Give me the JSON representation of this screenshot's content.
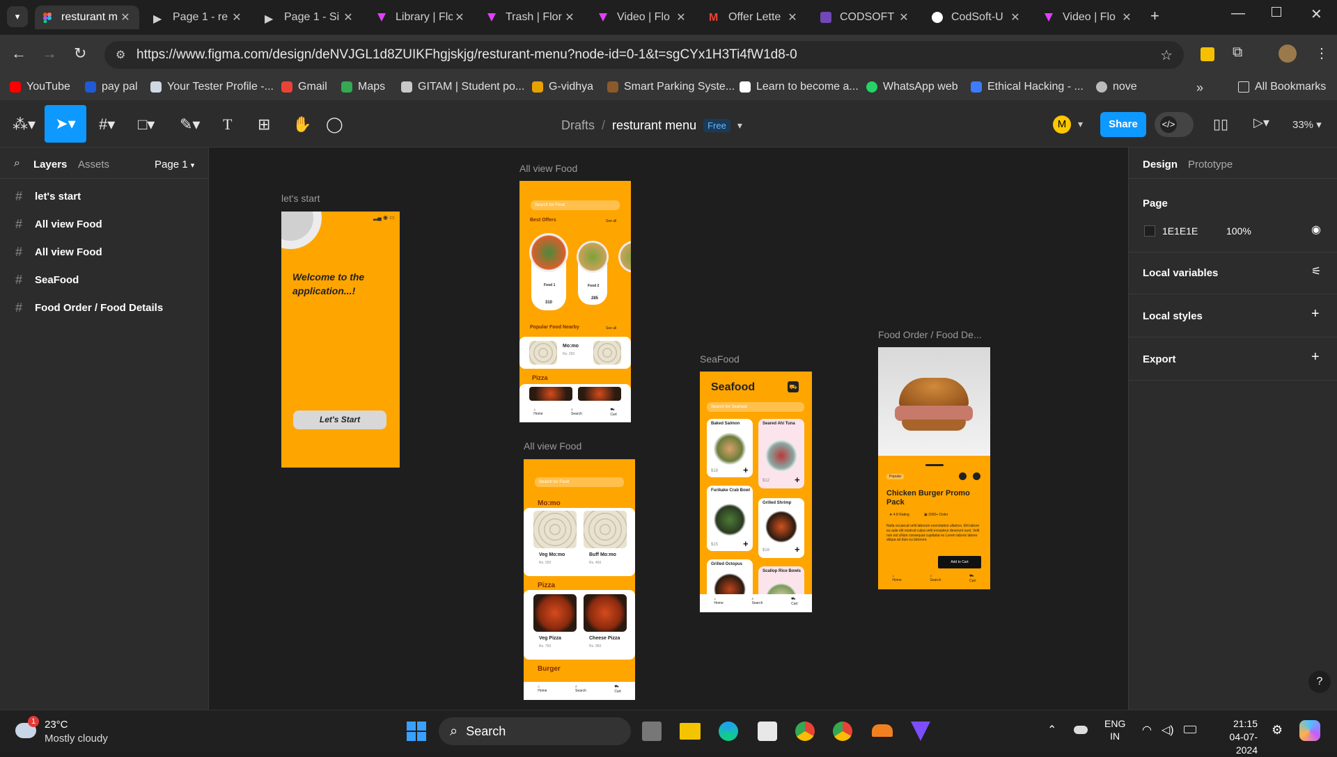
{
  "browser": {
    "tabs": [
      {
        "title": "resturant m",
        "active": true,
        "icon": "figma-icon"
      },
      {
        "title": "Page 1 - re",
        "icon": "play-icon"
      },
      {
        "title": "Page 1 - Si",
        "icon": "play-icon"
      },
      {
        "title": "Library | Flo",
        "icon": "flow-icon"
      },
      {
        "title": "Trash | Flor",
        "icon": "flow-icon"
      },
      {
        "title": "Video | Flo",
        "icon": "flow-icon"
      },
      {
        "title": "Offer Lette",
        "icon": "gmail-icon"
      },
      {
        "title": "CODSOFT",
        "icon": "form-icon"
      },
      {
        "title": "CodSoft-U",
        "icon": "github-icon"
      },
      {
        "title": "Video | Flo",
        "icon": "flow-icon"
      }
    ],
    "url": "https://www.figma.com/design/deNVJGL1d8ZUIKFhgjskjg/resturant-menu?node-id=0-1&t=sgCYx1H3Ti4fW1d8-0",
    "bookmarks": [
      {
        "label": "YouTube",
        "color": "#ff0000"
      },
      {
        "label": "pay pal",
        "color": "#1f5bd6"
      },
      {
        "label": "Your Tester Profile -...",
        "color": "#cfd8e3"
      },
      {
        "label": "Gmail",
        "color": "#ea4335"
      },
      {
        "label": "Maps",
        "color": "#34a853"
      },
      {
        "label": "GITAM | Student po...",
        "color": "#c9c9c9"
      },
      {
        "label": "G-vidhya",
        "color": "#e8a200"
      },
      {
        "label": "Smart Parking Syste...",
        "color": "#8b5a2b"
      },
      {
        "label": "Learn to become a...",
        "color": "#ffffff"
      },
      {
        "label": "WhatsApp web",
        "color": "#25d366"
      },
      {
        "label": "Ethical Hacking - ...",
        "color": "#3d7bff"
      },
      {
        "label": "nove",
        "color": "#bbbbbb"
      }
    ],
    "all_bookmarks": "All Bookmarks"
  },
  "figma": {
    "breadcrumb_drafts": "Drafts",
    "breadcrumb_sep": "/",
    "file_name": "resturant menu",
    "plan_badge": "Free",
    "avatar_initial": "M",
    "share": "Share",
    "zoom": "33%",
    "left_tabs": {
      "layers": "Layers",
      "assets": "Assets",
      "page": "Page 1"
    },
    "layers": [
      "let's start",
      "All view Food",
      "All view Food",
      "SeaFood",
      "Food Order / Food Details"
    ],
    "right_tabs": {
      "design": "Design",
      "prototype": "Prototype"
    },
    "page_section": {
      "title": "Page",
      "color_hex": "1E1E1E",
      "opacity": "100%"
    },
    "sections": [
      "Local variables",
      "Local styles",
      "Export"
    ],
    "help": "?"
  },
  "canvas": {
    "frame_labels": {
      "lets_start": "let's start",
      "all_view_1": "All view Food",
      "all_view_2": "All view Food",
      "seafood": "SeaFood",
      "food_order": "Food Order / Food De..."
    },
    "lets_start": {
      "welcome": "Welcome to the application...!",
      "button": "Let's Start"
    },
    "view1": {
      "search": "Search for Food",
      "best_offers": "Best Offers",
      "see_all": "See all",
      "food1": "Food 1",
      "food1_price": "310",
      "food2": "Food 2",
      "food2_price": "285",
      "popular": "Popular Food Nearby",
      "momo": "Mo:mo",
      "momo_price": "Rs. 250",
      "pizza": "Pizza",
      "nav": [
        "Home",
        "Search",
        "Cart"
      ]
    },
    "view2": {
      "search": "Search for Food",
      "momo": "Mo:mo",
      "veg_momo": "Veg Mo:mo",
      "veg_momo_price": "Rs. 250",
      "buff_momo": "Buff Mo:mo",
      "buff_momo_price": "Rs. 450",
      "pizza": "Pizza",
      "veg_pizza": "Veg Pizza",
      "veg_pizza_price": "Rs. 750",
      "cheese_pizza": "Cheese Pizza",
      "cheese_pizza_price": "Rs. 950",
      "burger": "Burger"
    },
    "seafood": {
      "title": "Seafood",
      "search": "Search for Seafood",
      "items": [
        {
          "name": "Baked Salmon",
          "price": "$18"
        },
        {
          "name": "Seared Ahi Tuna",
          "price": "$12"
        },
        {
          "name": "Furikake Crab Bowl",
          "price": "$15"
        },
        {
          "name": "Grilled Shrimp",
          "price": "$16"
        },
        {
          "name": "Grilled Octopus",
          "price": ""
        },
        {
          "name": "Scallop Rice Bowls",
          "price": ""
        }
      ]
    },
    "food_order": {
      "tag": "Popular",
      "title": "Chicken Burger Promo Pack",
      "rating": "4.8 Rating",
      "orders": "2000+ Order",
      "desc": "Nulla occaecat velit laborum exercitation ullamco. Elit labore eu aute elit nostrud culpa velit excepteur deserunt sunt. Velit non est cillum consequat cupidatat ex Lorem laboris labore aliqua ad duis eu laborum.",
      "add_to_cart": "Add to Cart"
    }
  },
  "taskbar": {
    "temp": "23°C",
    "weather": "Mostly cloudy",
    "weather_badge": "1",
    "search": "Search",
    "lang1": "ENG",
    "lang2": "IN",
    "time": "21:15",
    "date": "04-07-2024"
  }
}
